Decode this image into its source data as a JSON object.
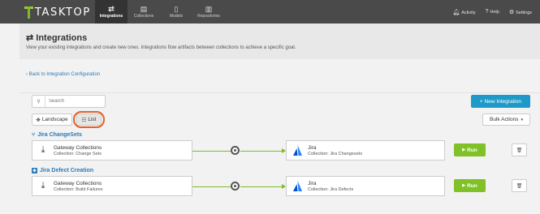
{
  "nav": {
    "logo": "TASKTOP",
    "tabs": [
      {
        "label": "Integrations",
        "icon": "arrows-icon",
        "active": true
      },
      {
        "label": "Collections",
        "icon": "collections-icon",
        "active": false
      },
      {
        "label": "Models",
        "icon": "models-icon",
        "active": false
      },
      {
        "label": "Repositories",
        "icon": "repositories-icon",
        "active": false
      }
    ],
    "activity": "Activity",
    "help": "Help",
    "settings": "Settings"
  },
  "header": {
    "title": "Integrations",
    "description": "View your existing integrations and create new ones. Integrations flow artifacts between collections to achieve a specific goal."
  },
  "back_link": "Back to Integration Configuration",
  "search": {
    "placeholder": "Search"
  },
  "new_integration": "+ New Integration",
  "view": {
    "landscape": "Landscape",
    "list": "List",
    "selected": "List"
  },
  "bulk_actions": "Bulk Actions",
  "integrations": [
    {
      "name": "Jira ChangeSets",
      "source": {
        "name": "Gateway Collections",
        "collection": "Collection: Change Sets"
      },
      "target": {
        "name": "Jira",
        "collection": "Collection: Jira Changesets"
      },
      "run": "Run"
    },
    {
      "name": "Jira Defect Creation",
      "source": {
        "name": "Gateway Collections",
        "collection": "Collection: Build Failures"
      },
      "target": {
        "name": "Jira",
        "collection": "Collection: Jira Defects"
      },
      "run": "Run"
    }
  ],
  "colors": {
    "accent": "#1f9ac8",
    "run": "#7fc127",
    "flow": "#7fb92c",
    "highlight": "#e1642a"
  }
}
